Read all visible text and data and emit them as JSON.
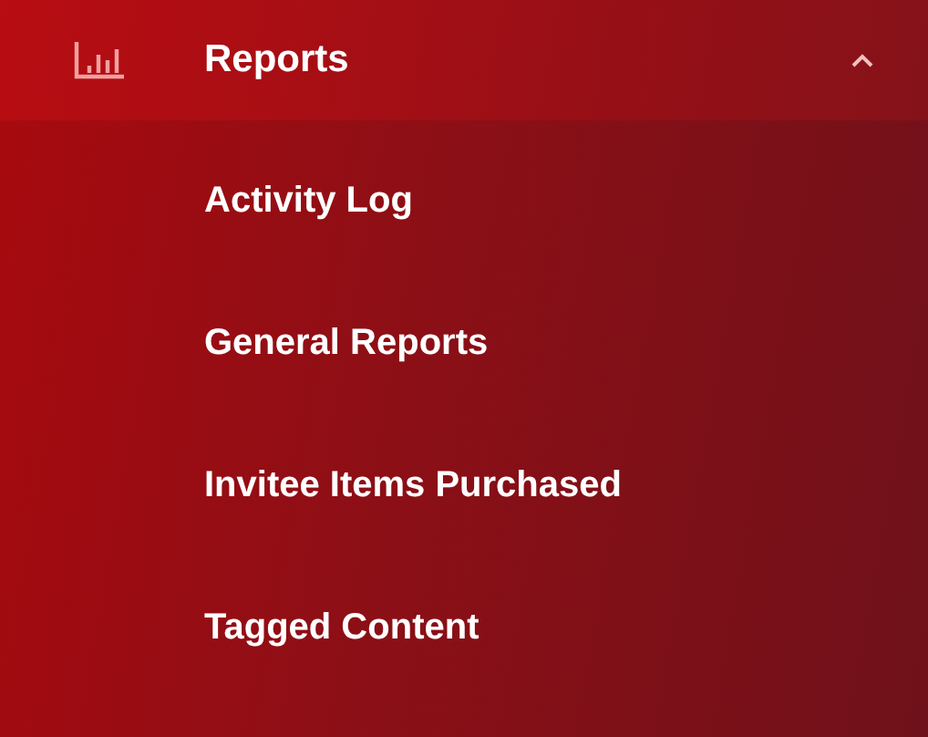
{
  "menu": {
    "label": "Reports",
    "expanded": true,
    "children": [
      {
        "label": "Activity Log"
      },
      {
        "label": "General Reports"
      },
      {
        "label": "Invitee Items Purchased"
      },
      {
        "label": "Tagged Content"
      }
    ]
  }
}
